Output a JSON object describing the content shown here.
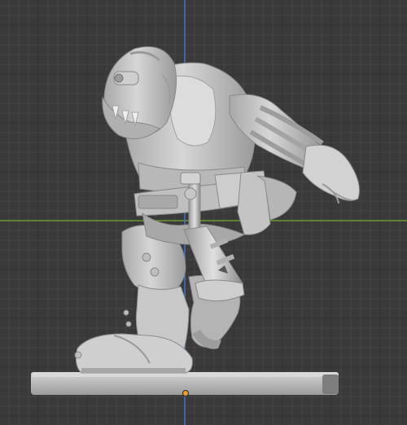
{
  "viewport": {
    "background_color": "#3a3a3a",
    "grid_minor_color": "#454545",
    "grid_major_color": "#333333",
    "axis_x_color": "#6b9a2e",
    "axis_z_color": "#3c74c9",
    "origin_color": "#f0a02a"
  },
  "model": {
    "material_color": "#c9c9c9",
    "shadow_color": "#8e8e8e",
    "highlight_color": "#e6e6e6",
    "base_color": "#b8b8b8"
  }
}
